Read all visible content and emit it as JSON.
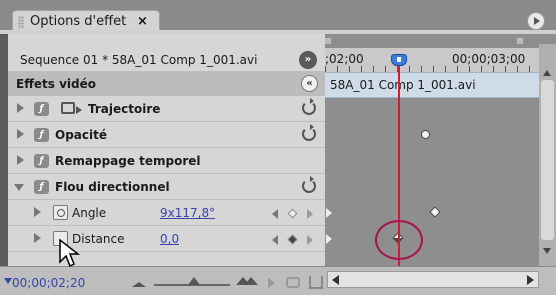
{
  "panel": {
    "tab_title": "Options d'effet",
    "tab_close": "×"
  },
  "header": {
    "sequence_label": "Sequence 01 * 58A_01 Comp 1_001.avi",
    "sequence_button": "»"
  },
  "section": {
    "title": "Effets vidéo",
    "collapse_button": "«"
  },
  "effects": [
    {
      "label": "Trajectoire",
      "fx": "ƒ",
      "expanded": false
    },
    {
      "label": "Opacité",
      "fx": "ƒ",
      "expanded": false
    },
    {
      "label": "Remappage temporel",
      "fx": "ƒ",
      "expanded": false
    },
    {
      "label": "Flou directionnel",
      "fx": "ƒ",
      "expanded": true
    }
  ],
  "properties": [
    {
      "label": "Angle",
      "value": "9x117,8°"
    },
    {
      "label": "Distance",
      "value": "0,0"
    }
  ],
  "timeline": {
    "time_left": ";02;00",
    "time_right": "00;00;03;00",
    "clip_label": "58A_01 Comp 1_001.avi",
    "playhead_color": "#d51c2b",
    "highlight_color": "#a31450"
  },
  "footer": {
    "current_time": "00;00;02;20"
  },
  "colors": {
    "accent_link": "#3a43a8",
    "clip_bar": "#cfdbe6",
    "playhead_head": "#3b7dd8"
  }
}
